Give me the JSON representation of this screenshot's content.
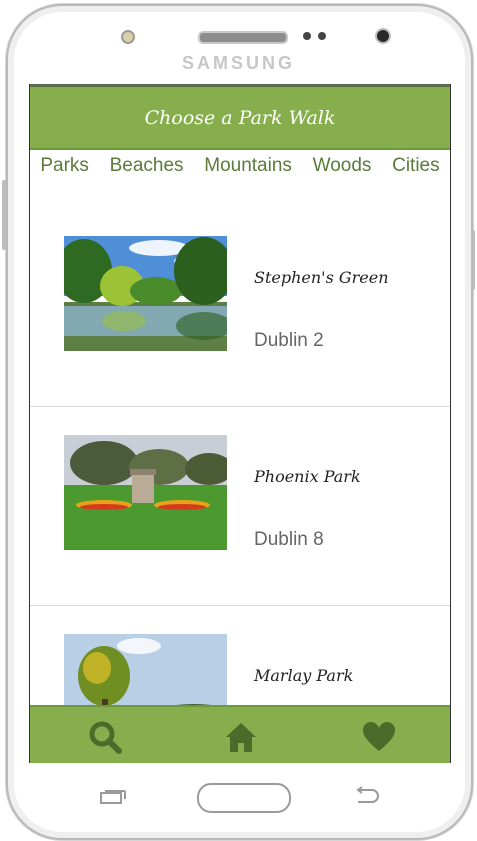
{
  "device": {
    "brand": "SAMSUNG"
  },
  "header": {
    "title": "Choose a Park Walk"
  },
  "tabs": [
    {
      "label": "Parks"
    },
    {
      "label": "Beaches"
    },
    {
      "label": "Mountains"
    },
    {
      "label": "Woods"
    },
    {
      "label": "Cities"
    }
  ],
  "parks": [
    {
      "name": "Stephen's Green",
      "area": "Dublin 2"
    },
    {
      "name": "Phoenix Park",
      "area": "Dublin 8"
    },
    {
      "name": "Marlay Park",
      "area": ""
    }
  ],
  "bottom_nav": {
    "icons": [
      "search-icon",
      "home-icon",
      "heart-icon"
    ],
    "color": "#4a6b2a"
  },
  "colors": {
    "accent": "#86ae4d",
    "tab_text": "#5b7a3a"
  }
}
